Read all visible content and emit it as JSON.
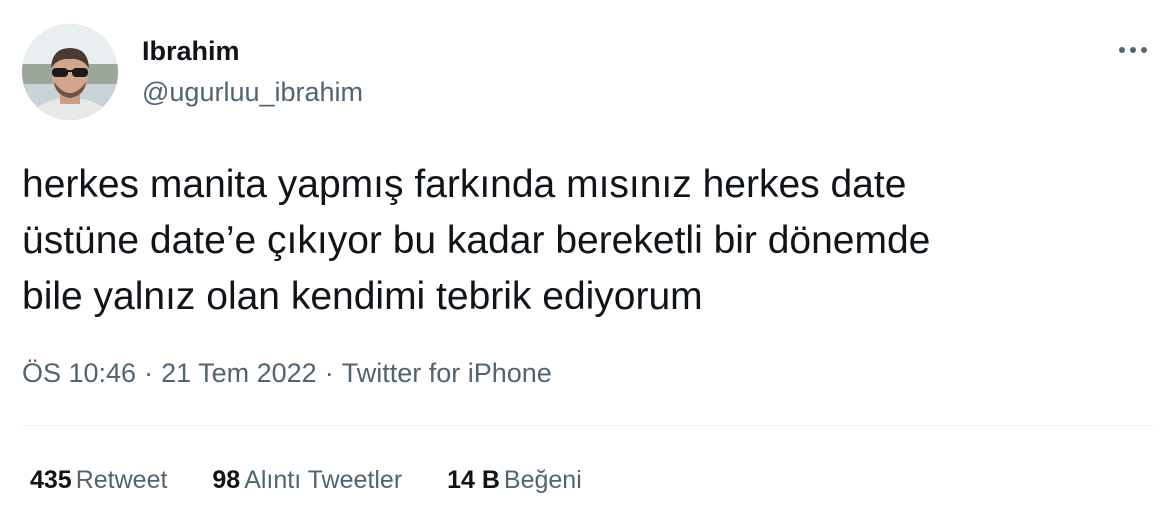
{
  "author": {
    "display_name": "Ibrahim",
    "handle": "@ugurluu_ibrahim",
    "avatar": "profile-photo"
  },
  "tweet": {
    "lines": [
      "herkes manita yapmış farkında mısınız herkes date",
      "üstüne date’e çıkıyor bu kadar bereketli bir dönemde",
      "bile yalnız olan kendimi tebrik ediyorum"
    ],
    "time": "ÖS 10:46",
    "date": "21 Tem 2022",
    "source": "Twitter for iPhone",
    "separator": "·"
  },
  "stats": {
    "retweets": {
      "count": "435",
      "label": "Retweet"
    },
    "quotes": {
      "count": "98",
      "label": "Alıntı Tweetler"
    },
    "likes": {
      "count": "14 B",
      "label": "Beğeni"
    }
  },
  "icons": {
    "more": "more-horizontal-icon"
  },
  "colors": {
    "text": "#0f1419",
    "secondary": "#536471",
    "divider": "#eff3f4"
  }
}
